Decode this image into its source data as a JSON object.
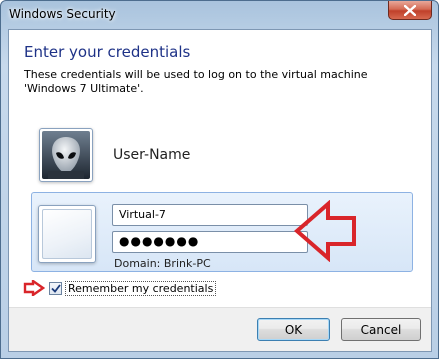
{
  "window": {
    "title": "Windows Security"
  },
  "dialog": {
    "heading": "Enter your credentials",
    "description": "These credentials will be used to log on to the virtual machine 'Windows 7 Ultimate'."
  },
  "saved_user": {
    "name": "User-Name",
    "tile_icon": "alien-avatar-icon"
  },
  "credentials": {
    "username_value": "Virtual-7",
    "password_value": "●●●●●●●",
    "domain_text": "Domain: Brink-PC"
  },
  "remember": {
    "label": "Remember my credentials",
    "checked": true
  },
  "buttons": {
    "ok_label": "OK",
    "cancel_label": "Cancel"
  },
  "colors": {
    "heading": "#1e3287",
    "annotation_arrow": "#d9252a",
    "panel_highlight": "#d7e6f7"
  }
}
